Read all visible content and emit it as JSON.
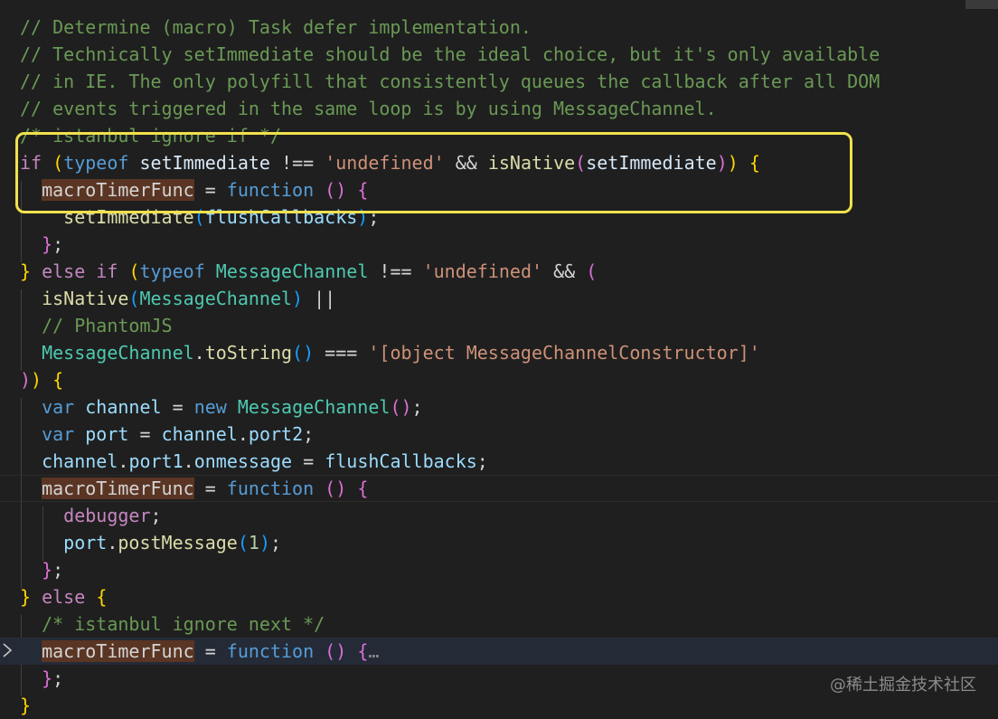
{
  "editor": {
    "theme_colors": {
      "background": "#1f1f1f",
      "comment": "#6a9955",
      "keyword": "#c586c0",
      "string": "#ce9178",
      "type": "#4ec9b0",
      "highlight_box": "#f2e14c"
    },
    "fold_icon": "chevron-right-icon",
    "lines": [
      [
        [
          "comment",
          "// Determine (macro) Task defer implementation."
        ]
      ],
      [
        [
          "comment",
          "// Technically setImmediate should be the ideal choice, but it's only available"
        ]
      ],
      [
        [
          "comment",
          "// in IE. The only polyfill that consistently queues the callback after all DOM"
        ]
      ],
      [
        [
          "comment",
          "// events triggered in the same loop is by using MessageChannel."
        ]
      ],
      [
        [
          "comment",
          "/* istanbul ignore if */"
        ]
      ],
      [
        [
          "keyword",
          "if"
        ],
        [
          "op",
          " "
        ],
        [
          "bracket-1",
          "("
        ],
        [
          "storage",
          "typeof"
        ],
        [
          "op",
          " "
        ],
        [
          "var",
          "setImmediate"
        ],
        [
          "op",
          " !== "
        ],
        [
          "string",
          "'undefined'"
        ],
        [
          "op",
          " && "
        ],
        [
          "func",
          "isNative"
        ],
        [
          "bracket-2",
          "("
        ],
        [
          "var",
          "setImmediate"
        ],
        [
          "bracket-2",
          ")"
        ],
        [
          "bracket-1",
          ")"
        ],
        [
          "op",
          " "
        ],
        [
          "bracket-1",
          "{"
        ]
      ],
      [
        [
          "op",
          "  "
        ],
        [
          "highlight",
          "macroTimerFunc"
        ],
        [
          "op",
          " = "
        ],
        [
          "storage",
          "function"
        ],
        [
          "op",
          " "
        ],
        [
          "bracket-2",
          "()"
        ],
        [
          "op",
          " "
        ],
        [
          "bracket-2",
          "{"
        ]
      ],
      [
        [
          "op",
          "    "
        ],
        [
          "func",
          "setImmediate"
        ],
        [
          "bracket-3",
          "("
        ],
        [
          "ident",
          "flushCallbacks"
        ],
        [
          "bracket-3",
          ")"
        ],
        [
          "op",
          ";"
        ]
      ],
      [
        [
          "op",
          "  "
        ],
        [
          "bracket-2",
          "}"
        ],
        [
          "op",
          ";"
        ]
      ],
      [
        [
          "bracket-1",
          "}"
        ],
        [
          "op",
          " "
        ],
        [
          "keyword",
          "else if"
        ],
        [
          "op",
          " "
        ],
        [
          "bracket-1",
          "("
        ],
        [
          "storage",
          "typeof"
        ],
        [
          "op",
          " "
        ],
        [
          "type",
          "MessageChannel"
        ],
        [
          "op",
          " !== "
        ],
        [
          "string",
          "'undefined'"
        ],
        [
          "op",
          " && "
        ],
        [
          "bracket-2",
          "("
        ]
      ],
      [
        [
          "op",
          "  "
        ],
        [
          "func",
          "isNative"
        ],
        [
          "bracket-3",
          "("
        ],
        [
          "type",
          "MessageChannel"
        ],
        [
          "bracket-3",
          ")"
        ],
        [
          "op",
          " ||"
        ]
      ],
      [
        [
          "op",
          "  "
        ],
        [
          "comment",
          "// PhantomJS"
        ]
      ],
      [
        [
          "op",
          "  "
        ],
        [
          "type",
          "MessageChannel"
        ],
        [
          "op",
          "."
        ],
        [
          "func",
          "toString"
        ],
        [
          "bracket-3",
          "()"
        ],
        [
          "op",
          " === "
        ],
        [
          "string",
          "'[object MessageChannelConstructor]'"
        ]
      ],
      [
        [
          "bracket-2",
          ")"
        ],
        [
          "bracket-1",
          ")"
        ],
        [
          "op",
          " "
        ],
        [
          "bracket-1",
          "{"
        ]
      ],
      [
        [
          "op",
          "  "
        ],
        [
          "storage",
          "var"
        ],
        [
          "op",
          " "
        ],
        [
          "ident",
          "channel"
        ],
        [
          "op",
          " = "
        ],
        [
          "storage",
          "new"
        ],
        [
          "op",
          " "
        ],
        [
          "type",
          "MessageChannel"
        ],
        [
          "bracket-2",
          "()"
        ],
        [
          "op",
          ";"
        ]
      ],
      [
        [
          "op",
          "  "
        ],
        [
          "storage",
          "var"
        ],
        [
          "op",
          " "
        ],
        [
          "ident",
          "port"
        ],
        [
          "op",
          " = "
        ],
        [
          "ident",
          "channel"
        ],
        [
          "op",
          "."
        ],
        [
          "ident",
          "port2"
        ],
        [
          "op",
          ";"
        ]
      ],
      [
        [
          "op",
          "  "
        ],
        [
          "ident",
          "channel"
        ],
        [
          "op",
          "."
        ],
        [
          "ident",
          "port1"
        ],
        [
          "op",
          "."
        ],
        [
          "ident",
          "onmessage"
        ],
        [
          "op",
          " = "
        ],
        [
          "ident",
          "flushCallbacks"
        ],
        [
          "op",
          ";"
        ]
      ],
      [
        [
          "op",
          "  "
        ],
        [
          "highlight",
          "macroTimerFunc"
        ],
        [
          "op",
          " = "
        ],
        [
          "storage",
          "function"
        ],
        [
          "op",
          " "
        ],
        [
          "bracket-2",
          "()"
        ],
        [
          "op",
          " "
        ],
        [
          "bracket-2",
          "{"
        ]
      ],
      [
        [
          "op",
          "    "
        ],
        [
          "keyword",
          "debugger"
        ],
        [
          "op",
          ";"
        ]
      ],
      [
        [
          "op",
          "    "
        ],
        [
          "ident",
          "port"
        ],
        [
          "op",
          "."
        ],
        [
          "func",
          "postMessage"
        ],
        [
          "bracket-3",
          "("
        ],
        [
          "number",
          "1"
        ],
        [
          "bracket-3",
          ")"
        ],
        [
          "op",
          ";"
        ]
      ],
      [
        [
          "op",
          "  "
        ],
        [
          "bracket-2",
          "}"
        ],
        [
          "op",
          ";"
        ]
      ],
      [
        [
          "bracket-1",
          "}"
        ],
        [
          "op",
          " "
        ],
        [
          "keyword",
          "else"
        ],
        [
          "op",
          " "
        ],
        [
          "bracket-1",
          "{"
        ]
      ],
      [
        [
          "op",
          "  "
        ],
        [
          "comment",
          "/* istanbul ignore next */"
        ]
      ],
      [
        [
          "op",
          "  "
        ],
        [
          "highlight",
          "macroTimerFunc"
        ],
        [
          "op",
          " = "
        ],
        [
          "storage",
          "function"
        ],
        [
          "op",
          " "
        ],
        [
          "bracket-2",
          "()"
        ],
        [
          "op",
          " "
        ],
        [
          "bracket-2",
          "{"
        ],
        [
          "ellipsis",
          "…"
        ]
      ],
      [
        [
          "op",
          "  "
        ],
        [
          "bracket-2",
          "}"
        ],
        [
          "op",
          ";"
        ]
      ],
      [
        [
          "bracket-1",
          "}"
        ]
      ]
    ]
  },
  "watermark": "@稀土掘金技术社区"
}
